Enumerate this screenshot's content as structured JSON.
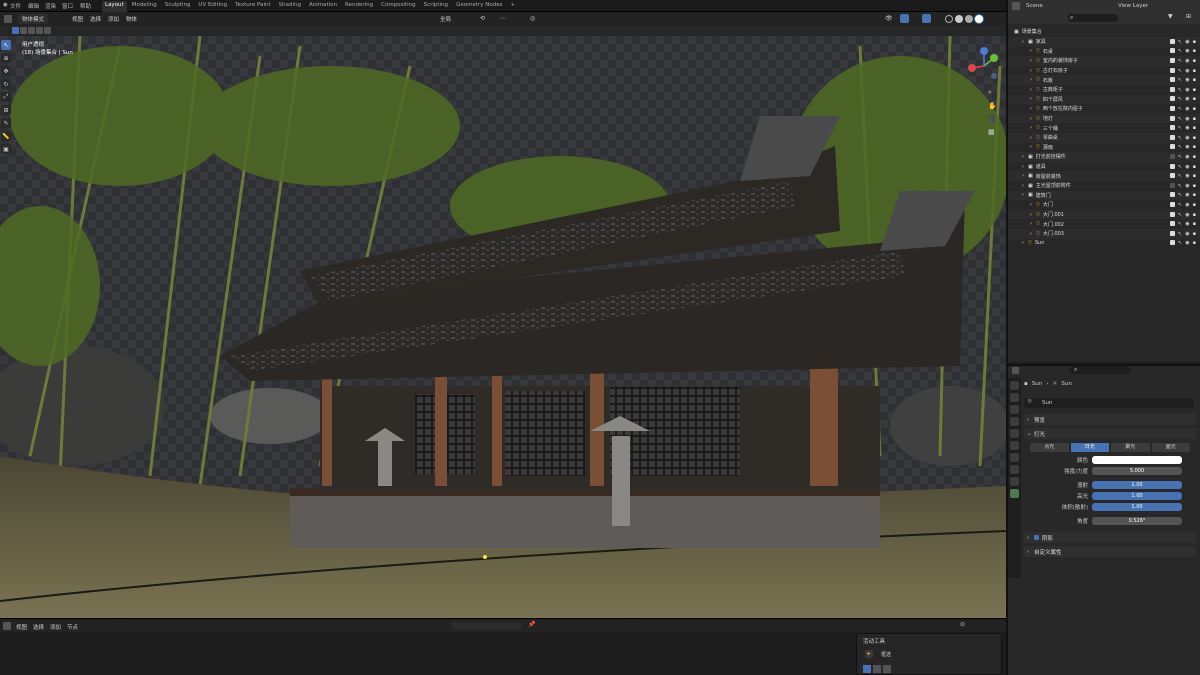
{
  "menu": {
    "items": [
      "文件",
      "编辑",
      "渲染",
      "窗口",
      "帮助"
    ],
    "workspaces": [
      "Layout",
      "Modeling",
      "Sculpting",
      "UV Editing",
      "Texture Paint",
      "Shading",
      "Animation",
      "Rendering",
      "Compositing",
      "Scripting",
      "Geometry Nodes",
      "+"
    ],
    "active_workspace": "Layout",
    "scene": "Scene",
    "view_layer": "View Layer"
  },
  "viewport": {
    "mode": "物体模式",
    "menus": [
      "视图",
      "选择",
      "添加",
      "物体"
    ],
    "transform": "全局",
    "overlay_label": "透视",
    "info_line1": "用户透视",
    "info_line2": "(18) 场景集合 | Sun"
  },
  "outliner": {
    "root": "场景集合",
    "rows": [
      {
        "name": "家具",
        "depth": 1,
        "on": true
      },
      {
        "name": "石桌",
        "depth": 2,
        "on": true
      },
      {
        "name": "室内的装饰房子",
        "depth": 2,
        "on": true
      },
      {
        "name": "古灯石房子",
        "depth": 2,
        "on": true
      },
      {
        "name": "石板",
        "depth": 2,
        "on": true
      },
      {
        "name": "古典柜子",
        "depth": 2,
        "on": true
      },
      {
        "name": "四个屏风",
        "depth": 2,
        "on": true
      },
      {
        "name": "两个放在院内屋子",
        "depth": 2,
        "on": true
      },
      {
        "name": "地灯",
        "depth": 2,
        "on": true
      },
      {
        "name": "三个桶",
        "depth": 2,
        "on": true
      },
      {
        "name": "琴曲桌",
        "depth": 2,
        "on": true
      },
      {
        "name": "蒲扇",
        "depth": 2,
        "on": true
      },
      {
        "name": "打光前挂摆件",
        "depth": 1,
        "on": false
      },
      {
        "name": "道具",
        "depth": 1,
        "on": true
      },
      {
        "name": "房屋前装饰",
        "depth": 1,
        "on": true
      },
      {
        "name": "主光屋顶前附件",
        "depth": 1,
        "on": false
      },
      {
        "name": "建筑门",
        "depth": 1,
        "on": true
      },
      {
        "name": "大门",
        "depth": 2,
        "on": true
      },
      {
        "name": "大门.001",
        "depth": 2,
        "on": true
      },
      {
        "name": "大门.002",
        "depth": 2,
        "on": true
      },
      {
        "name": "大门.003",
        "depth": 2,
        "on": true
      },
      {
        "name": "Sun",
        "depth": 1,
        "on": true
      }
    ]
  },
  "properties": {
    "breadcrumb_obj": "Sun",
    "breadcrumb_data": "Sun",
    "datablock": "Sun",
    "sections": {
      "preview": "预览",
      "light": "灯光",
      "shadow": "阴影",
      "custom": "自定义属性"
    },
    "light_types": [
      "点光",
      "日光",
      "聚光",
      "面光"
    ],
    "active_light_type": "日光",
    "fields": [
      {
        "label": "颜色",
        "value": "",
        "style": "white"
      },
      {
        "label": "强度/力度",
        "value": "5.000",
        "style": "grey"
      },
      {
        "label": "漫射",
        "value": "1.00",
        "style": "blue"
      },
      {
        "label": "高光",
        "value": "1.00",
        "style": "blue"
      },
      {
        "label": "体积(散射)",
        "value": "1.00",
        "style": "blue"
      },
      {
        "label": "角度",
        "value": "0.526°",
        "style": "grey"
      }
    ]
  },
  "timeline": {
    "menus": [
      "视图",
      "选择",
      "添加",
      "节点"
    ],
    "active_tool_title": "活动工具",
    "active_tool_label": "框选"
  },
  "colors": {
    "accent": "#4772b3",
    "sky": "#2f3135",
    "ground": "#6b6446"
  }
}
